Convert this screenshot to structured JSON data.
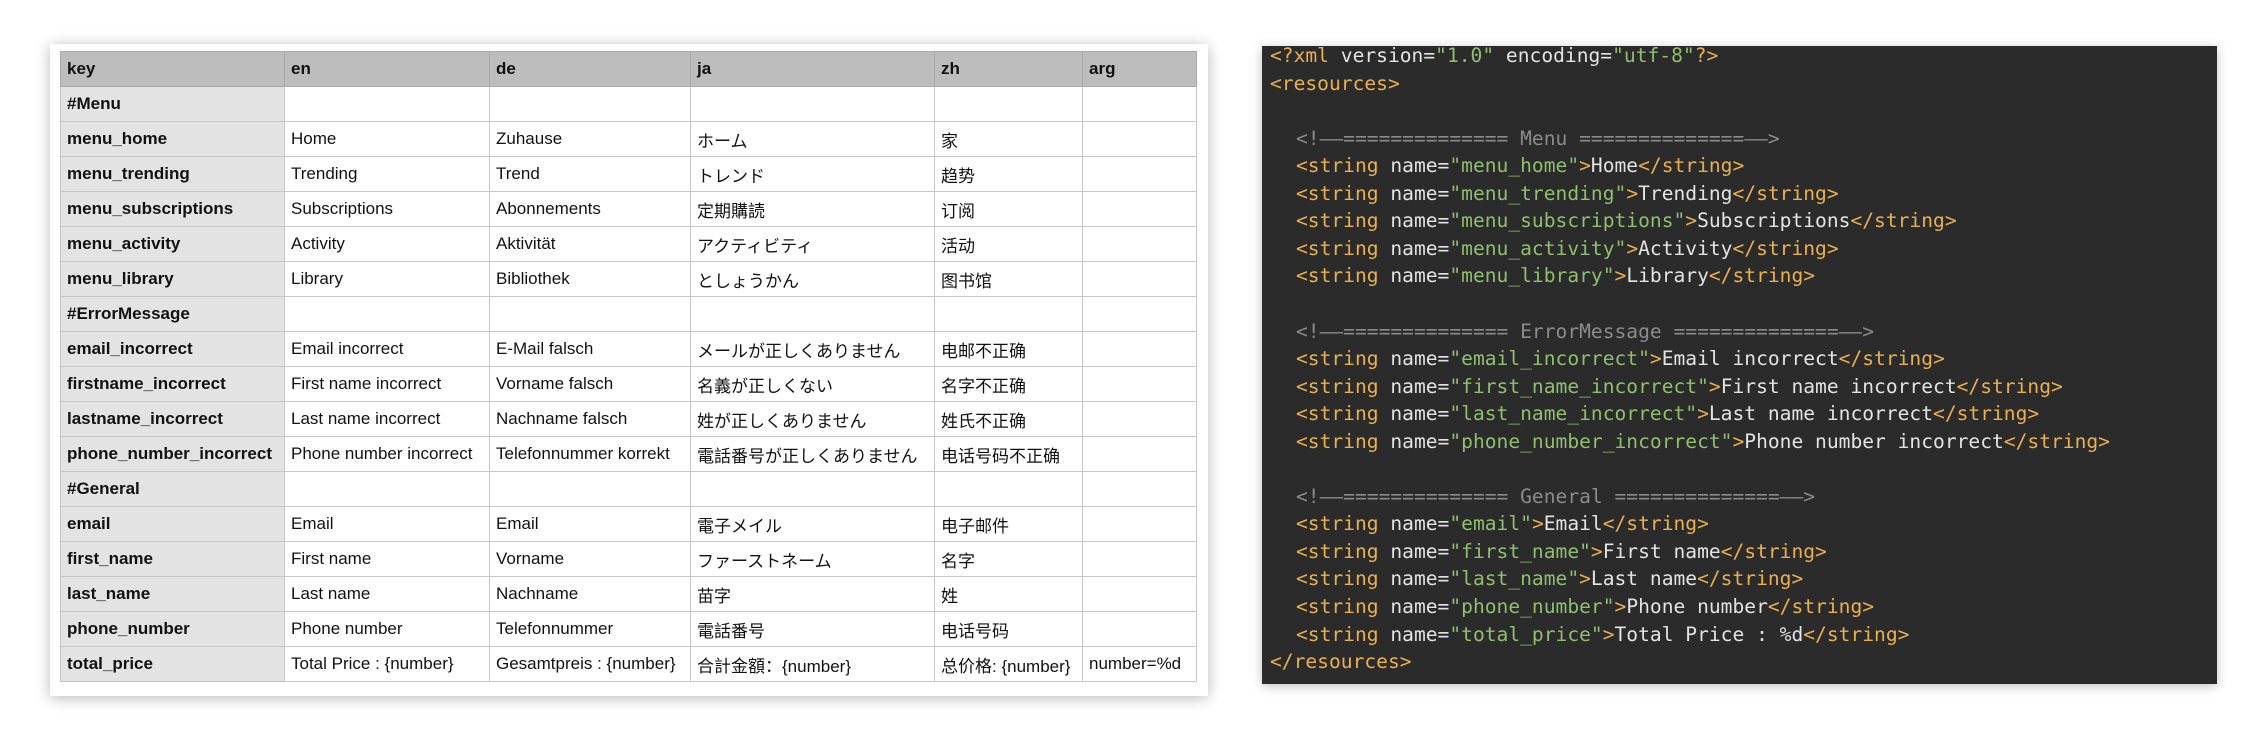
{
  "sheet": {
    "columns": [
      "key",
      "en",
      "de",
      "ja",
      "zh",
      "arg"
    ],
    "rows": [
      [
        "#Menu",
        "",
        "",
        "",
        "",
        ""
      ],
      [
        "menu_home",
        "Home",
        "Zuhause",
        "ホーム",
        "家",
        ""
      ],
      [
        "menu_trending",
        "Trending",
        "Trend",
        "トレンド",
        "趋势",
        ""
      ],
      [
        "menu_subscriptions",
        "Subscriptions",
        "Abonnements",
        "定期購読",
        "订阅",
        ""
      ],
      [
        "menu_activity",
        "Activity",
        "Aktivität",
        "アクティビティ",
        "活动",
        ""
      ],
      [
        "menu_library",
        "Library",
        "Bibliothek",
        "としょうかん",
        "图书馆",
        ""
      ],
      [
        "#ErrorMessage",
        "",
        "",
        "",
        "",
        ""
      ],
      [
        "email_incorrect",
        "Email incorrect",
        "E-Mail falsch",
        "メールが正しくありません",
        "电邮不正确",
        ""
      ],
      [
        "firstname_incorrect",
        "First name incorrect",
        "Vorname falsch",
        "名義が正しくない",
        "名字不正确",
        ""
      ],
      [
        "lastname_incorrect",
        "Last name incorrect",
        "Nachname falsch",
        "姓が正しくありません",
        "姓氏不正确",
        ""
      ],
      [
        "phone_number_incorrect",
        "Phone number incorrect",
        "Telefonnummer korrekt",
        "電話番号が正しくありません",
        "电话号码不正确",
        ""
      ],
      [
        "#General",
        "",
        "",
        "",
        "",
        ""
      ],
      [
        "email",
        "Email",
        "Email",
        "電子メイル",
        "电子邮件",
        ""
      ],
      [
        "first_name",
        "First name",
        "Vorname",
        "ファーストネーム",
        "名字",
        ""
      ],
      [
        "last_name",
        "Last name",
        "Nachname",
        "苗字",
        "姓",
        ""
      ],
      [
        "phone_number",
        "Phone number",
        "Telefonnummer",
        "電話番号",
        "电话号码",
        ""
      ],
      [
        "total_price",
        "Total Price : {number}",
        "Gesamtpreis : {number}",
        "合計金額：{number}",
        "总价格: {number}",
        "number=%d"
      ]
    ]
  },
  "code": {
    "lines": [
      {
        "indent": 0,
        "tokens": [
          [
            "k",
            "<?xml"
          ],
          [
            "a",
            " version="
          ],
          [
            "s",
            "\"1.0\""
          ],
          [
            "a",
            " encoding="
          ],
          [
            "s",
            "\"utf-8\""
          ],
          [
            "k",
            "?>"
          ]
        ]
      },
      {
        "indent": 0,
        "tokens": [
          [
            "k",
            "<resources>"
          ]
        ]
      },
      {
        "indent": 0,
        "tokens": []
      },
      {
        "indent": 1,
        "tokens": [
          [
            "c",
            "<!——============== Menu ==============——>"
          ]
        ]
      },
      {
        "indent": 1,
        "tokens": [
          [
            "k",
            "<string"
          ],
          [
            "a",
            " name="
          ],
          [
            "s",
            "\"menu_home\""
          ],
          [
            "k",
            ">"
          ],
          [
            "a",
            "Home"
          ],
          [
            "k",
            "</string>"
          ]
        ]
      },
      {
        "indent": 1,
        "tokens": [
          [
            "k",
            "<string"
          ],
          [
            "a",
            " name="
          ],
          [
            "s",
            "\"menu_trending\""
          ],
          [
            "k",
            ">"
          ],
          [
            "a",
            "Trending"
          ],
          [
            "k",
            "</string>"
          ]
        ]
      },
      {
        "indent": 1,
        "tokens": [
          [
            "k",
            "<string"
          ],
          [
            "a",
            " name="
          ],
          [
            "s",
            "\"menu_subscriptions\""
          ],
          [
            "k",
            ">"
          ],
          [
            "a",
            "Subscriptions"
          ],
          [
            "k",
            "</string>"
          ]
        ]
      },
      {
        "indent": 1,
        "tokens": [
          [
            "k",
            "<string"
          ],
          [
            "a",
            " name="
          ],
          [
            "s",
            "\"menu_activity\""
          ],
          [
            "k",
            ">"
          ],
          [
            "a",
            "Activity"
          ],
          [
            "k",
            "</string>"
          ]
        ]
      },
      {
        "indent": 1,
        "tokens": [
          [
            "k",
            "<string"
          ],
          [
            "a",
            " name="
          ],
          [
            "s",
            "\"menu_library\""
          ],
          [
            "k",
            ">"
          ],
          [
            "a",
            "Library"
          ],
          [
            "k",
            "</string>"
          ]
        ]
      },
      {
        "indent": 0,
        "tokens": []
      },
      {
        "indent": 1,
        "tokens": [
          [
            "c",
            "<!——============== ErrorMessage ==============——>"
          ]
        ]
      },
      {
        "indent": 1,
        "tokens": [
          [
            "k",
            "<string"
          ],
          [
            "a",
            " name="
          ],
          [
            "s",
            "\"email_incorrect\""
          ],
          [
            "k",
            ">"
          ],
          [
            "a",
            "Email incorrect"
          ],
          [
            "k",
            "</string>"
          ]
        ]
      },
      {
        "indent": 1,
        "tokens": [
          [
            "k",
            "<string"
          ],
          [
            "a",
            " name="
          ],
          [
            "s",
            "\"first_name_incorrect\""
          ],
          [
            "k",
            ">"
          ],
          [
            "a",
            "First name incorrect"
          ],
          [
            "k",
            "</string>"
          ]
        ]
      },
      {
        "indent": 1,
        "tokens": [
          [
            "k",
            "<string"
          ],
          [
            "a",
            " name="
          ],
          [
            "s",
            "\"last_name_incorrect\""
          ],
          [
            "k",
            ">"
          ],
          [
            "a",
            "Last name incorrect"
          ],
          [
            "k",
            "</string>"
          ]
        ]
      },
      {
        "indent": 1,
        "tokens": [
          [
            "k",
            "<string"
          ],
          [
            "a",
            " name="
          ],
          [
            "s",
            "\"phone_number_incorrect\""
          ],
          [
            "k",
            ">"
          ],
          [
            "a",
            "Phone number incorrect"
          ],
          [
            "k",
            "</string>"
          ]
        ]
      },
      {
        "indent": 0,
        "tokens": []
      },
      {
        "indent": 1,
        "tokens": [
          [
            "c",
            "<!——============== General ==============——>"
          ]
        ]
      },
      {
        "indent": 1,
        "tokens": [
          [
            "k",
            "<string"
          ],
          [
            "a",
            " name="
          ],
          [
            "s",
            "\"email\""
          ],
          [
            "k",
            ">"
          ],
          [
            "a",
            "Email"
          ],
          [
            "k",
            "</string>"
          ]
        ]
      },
      {
        "indent": 1,
        "tokens": [
          [
            "k",
            "<string"
          ],
          [
            "a",
            " name="
          ],
          [
            "s",
            "\"first_name\""
          ],
          [
            "k",
            ">"
          ],
          [
            "a",
            "First name"
          ],
          [
            "k",
            "</string>"
          ]
        ]
      },
      {
        "indent": 1,
        "tokens": [
          [
            "k",
            "<string"
          ],
          [
            "a",
            " name="
          ],
          [
            "s",
            "\"last_name\""
          ],
          [
            "k",
            ">"
          ],
          [
            "a",
            "Last name"
          ],
          [
            "k",
            "</string>"
          ]
        ]
      },
      {
        "indent": 1,
        "tokens": [
          [
            "k",
            "<string"
          ],
          [
            "a",
            " name="
          ],
          [
            "s",
            "\"phone_number\""
          ],
          [
            "k",
            ">"
          ],
          [
            "a",
            "Phone number"
          ],
          [
            "k",
            "</string>"
          ]
        ]
      },
      {
        "indent": 1,
        "tokens": [
          [
            "k",
            "<string"
          ],
          [
            "a",
            " name="
          ],
          [
            "s",
            "\"total_price\""
          ],
          [
            "k",
            ">"
          ],
          [
            "a",
            "Total Price : %d"
          ],
          [
            "k",
            "</string>"
          ]
        ]
      },
      {
        "indent": 0,
        "tokens": [
          [
            "k",
            "</resources>"
          ]
        ]
      }
    ]
  },
  "colors": {
    "code_background": "#2b2b2b",
    "code_keyword": "#e9b04f",
    "code_string": "#8fbf6f",
    "code_comment": "#8b8b8b",
    "sheet_header": "#bdbdbd",
    "sheet_key_column": "#e3e3e3"
  }
}
